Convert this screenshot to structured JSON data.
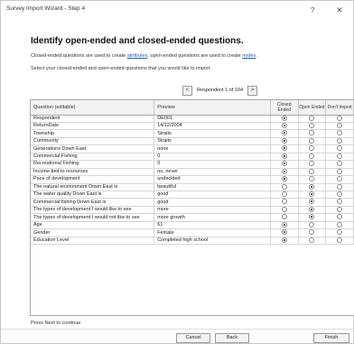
{
  "window": {
    "title": "Survey Import Wizard - Step 4",
    "help_label": "?",
    "close_label": "✕"
  },
  "page": {
    "heading": "Identify open-ended and closed-ended questions.",
    "desc_part1": "Closed-ended questions are used to create ",
    "desc_link1": "attributes",
    "desc_part2": ", open-ended questions are used to create ",
    "desc_link2": "nodes",
    "desc_part3": ".",
    "instruction": "Select your closed-ended and open-ended questions that you would like to import."
  },
  "navigator": {
    "prev_label": "<",
    "next_label": ">",
    "label": "Respondent 1 of 104"
  },
  "grid": {
    "columns": {
      "question": "Question (editable)",
      "preview": "Preview",
      "closed": "Closed Ended",
      "open": "Open Ended",
      "dont": "Don't Import"
    },
    "rows": [
      {
        "question": "Respondent",
        "preview": "DE001",
        "selection": "closed"
      },
      {
        "question": "ReturnDate",
        "preview": "14/12/2004",
        "selection": "closed"
      },
      {
        "question": "Township",
        "preview": "Straits",
        "selection": "closed"
      },
      {
        "question": "Community",
        "preview": "Straits",
        "selection": "closed"
      },
      {
        "question": "Generations Down East",
        "preview": "none",
        "selection": "closed"
      },
      {
        "question": "Commercial Fishing",
        "preview": "0",
        "selection": "closed"
      },
      {
        "question": "Recreational Fishing",
        "preview": "0",
        "selection": "closed"
      },
      {
        "question": "Income tied to resources",
        "preview": "no, never",
        "selection": "closed"
      },
      {
        "question": "Pace of development",
        "preview": "undecided",
        "selection": "closed"
      },
      {
        "question": "The natural environment Down East is",
        "preview": "beautiful",
        "selection": "open"
      },
      {
        "question": "The water quality Down East is",
        "preview": "good",
        "selection": "open"
      },
      {
        "question": "Commercial fishing Down East is",
        "preview": "good",
        "selection": "open"
      },
      {
        "question": "The types of development I would like to see",
        "preview": "more",
        "selection": "open"
      },
      {
        "question": "The types of development I would not like to see",
        "preview": "more growth",
        "selection": "open"
      },
      {
        "question": "Age",
        "preview": "61",
        "selection": "closed"
      },
      {
        "question": "Gender",
        "preview": "Female",
        "selection": "closed"
      },
      {
        "question": "Education Level",
        "preview": "Completed high school",
        "selection": "closed"
      }
    ]
  },
  "status": {
    "text": "Press Next to continue"
  },
  "buttons": {
    "cancel": "Cancel",
    "back": "Back",
    "finish": "Finish"
  }
}
